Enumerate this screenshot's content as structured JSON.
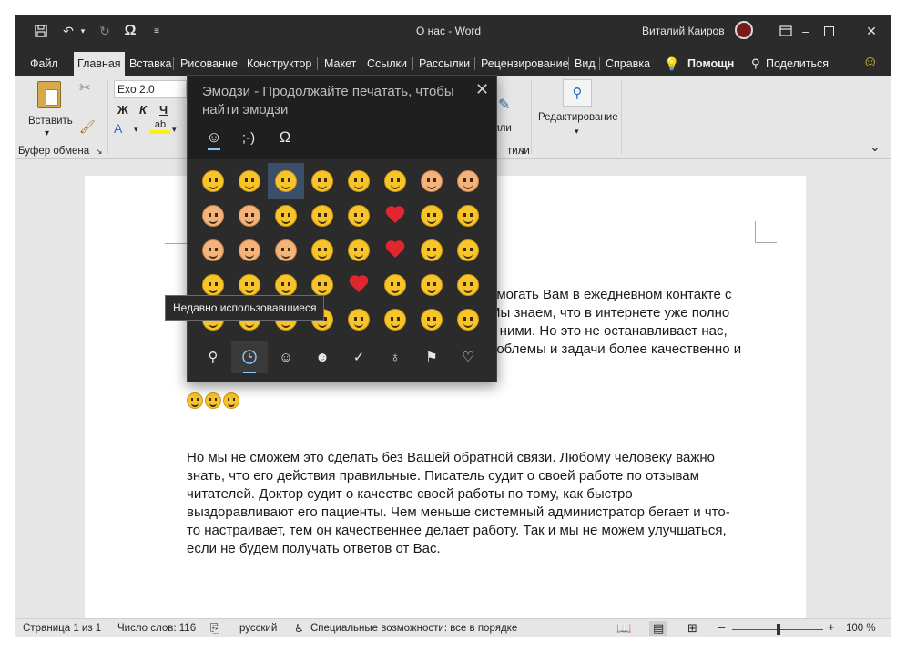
{
  "titlebar": {
    "title": "О нас  -  Word",
    "user": "Виталий Каиров",
    "icons": [
      "save-icon",
      "undo-icon",
      "redo-icon",
      "omega-icon",
      "customize-icon"
    ]
  },
  "tabs": [
    "Файл",
    "Главная",
    "Вставка",
    "Рисование",
    "Конструктор",
    "Макет",
    "Ссылки",
    "Рассылки",
    "Рецензирование",
    "Вид",
    "Справка"
  ],
  "tab_extras": {
    "help_search": "Помощн",
    "share": "Поделиться"
  },
  "ribbon": {
    "paste": "Вставить",
    "clipboard_group": "Буфер обмена",
    "font_name": "Exo 2.0",
    "bold": "Ж",
    "italic": "К",
    "underline": "Ч",
    "styles_partial": "тили",
    "editing": "Редактирование"
  },
  "emoji_panel": {
    "title": "Эмодзи - Продолжайте печатать, чтобы найти эмодзи",
    "tabs": [
      "☺",
      ";-)",
      "Ω"
    ],
    "tooltip": "Недавно использовавшиеся"
  },
  "document": {
    "para1": [
      "омогать Вам в ежедневном контакте с",
      "Мы знаем, что в интернете уже полно",
      "с ними. Но это не останавливает нас,",
      "роблемы и задачи более качественно и"
    ],
    "para2": [
      "Но мы не сможем это сделать без Вашей обратной связи. Любому человеку важно",
      "знать, что его действия правильные. Писатель судит о своей работе по отзывам",
      "читателей. Доктор судит о качестве своей работы по тому, как быстро",
      "выздоравливают его пациенты. Чем меньше системный администратор бегает и что-",
      "то настраивает, тем он качественнее делает работу. Так и мы не можем улучшаться,",
      "если не будем получать ответов от Вас."
    ]
  },
  "statusbar": {
    "page": "Страница 1 из 1",
    "words": "Число слов: 116",
    "language": "русский",
    "accessibility": "Специальные возможности: все в порядке",
    "zoom": "100 %",
    "zoom_level": 1.0
  },
  "colors": {
    "dark": "#2b2b2b",
    "ribbon": "#e6e6e6",
    "accent": "#8ec8ff",
    "emoji": "#f7c52a"
  }
}
